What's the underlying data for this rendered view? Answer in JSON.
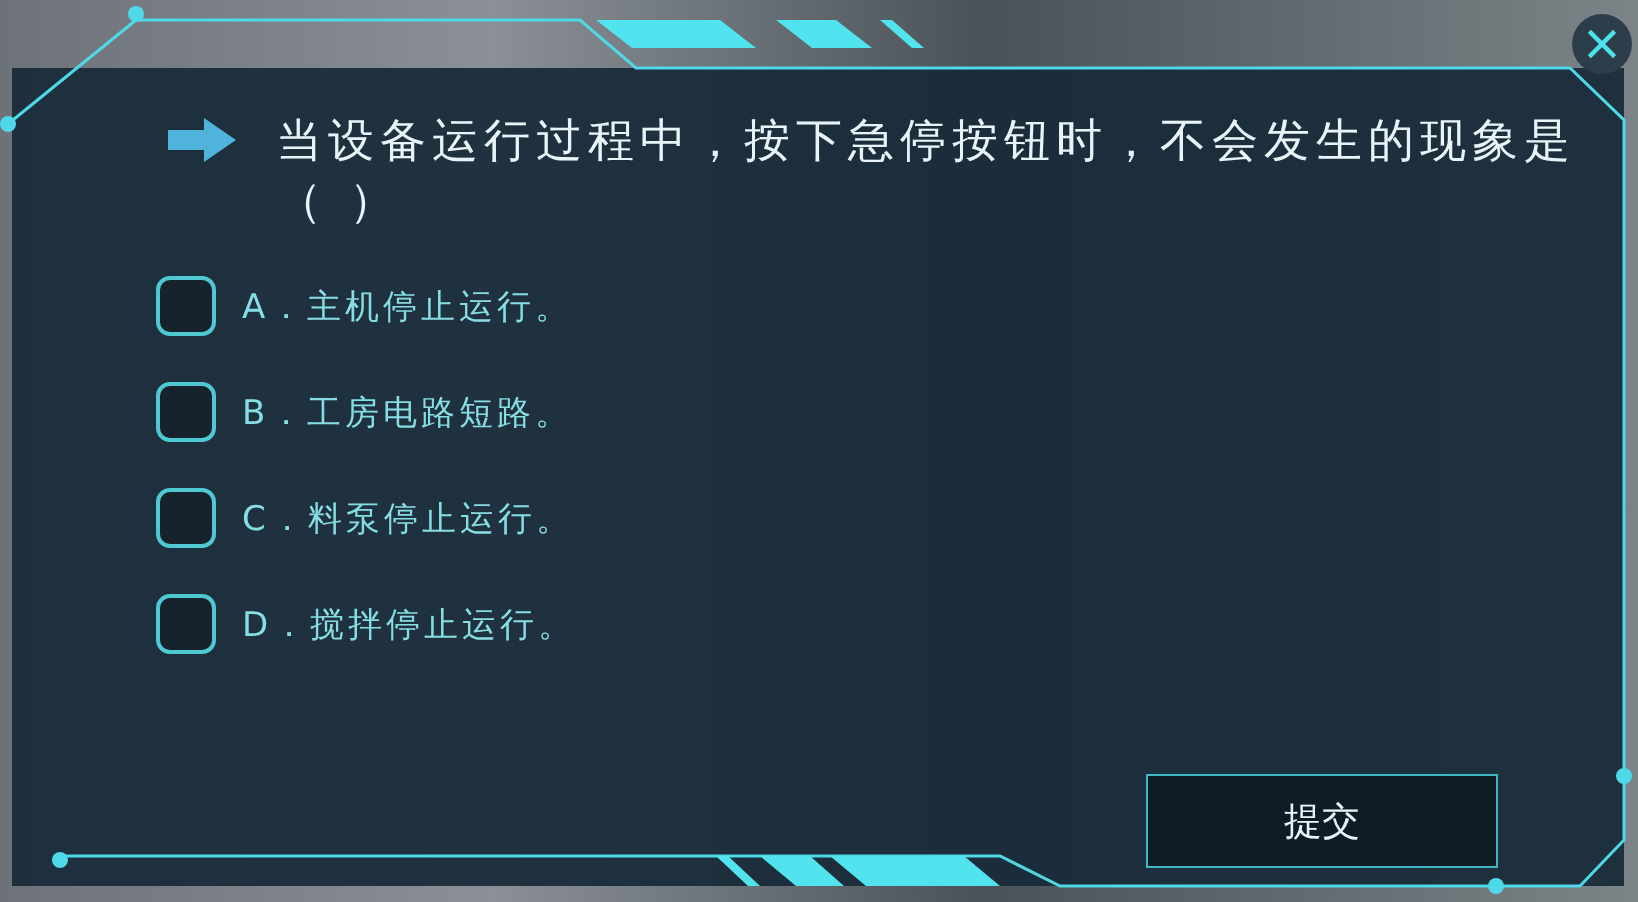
{
  "question": {
    "text": "当设备运行过程中，按下急停按钮时，不会发生的现象是（ ）"
  },
  "options": [
    {
      "label": "A．主机停止运行。",
      "checked": false
    },
    {
      "label": "B．工房电路短路。",
      "checked": false
    },
    {
      "label": "C．料泵停止运行。",
      "checked": false
    },
    {
      "label": "D．搅拌停止运行。",
      "checked": false
    }
  ],
  "submit_button": {
    "label": "提交"
  }
}
